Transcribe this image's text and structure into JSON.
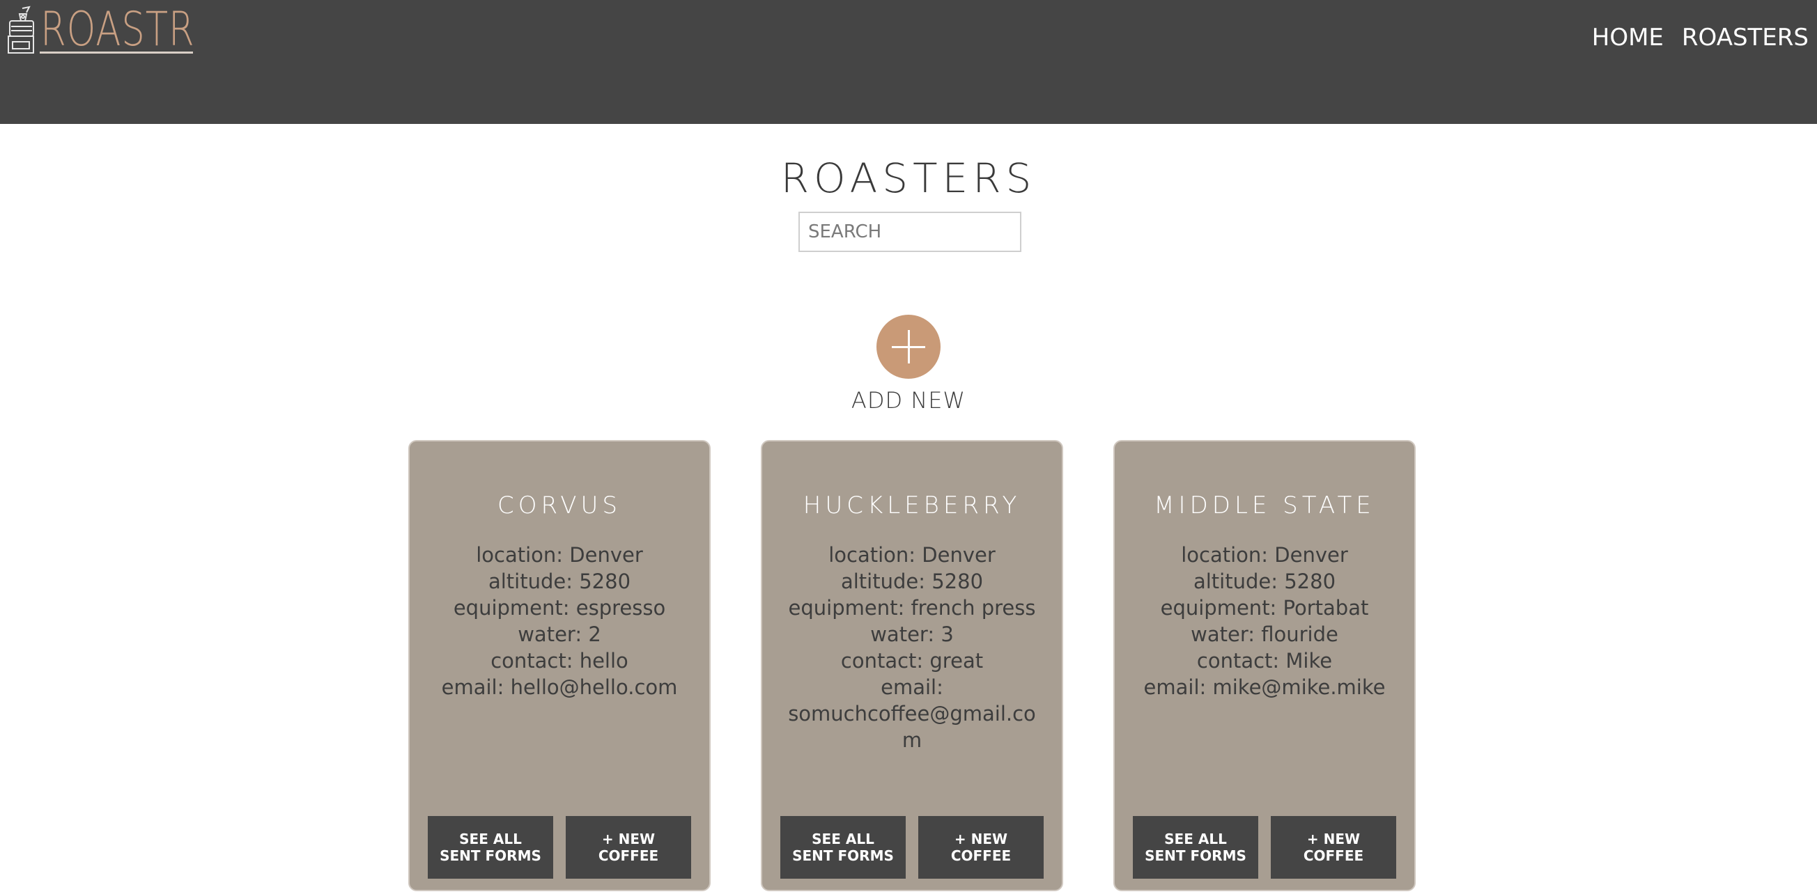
{
  "header": {
    "logo_text": "ROASTR",
    "nav": [
      {
        "label": "HOME"
      },
      {
        "label": "ROASTERS"
      }
    ]
  },
  "main": {
    "title": "ROASTERS",
    "search": {
      "placeholder": "SEARCH",
      "value": ""
    },
    "add_new_label": "ADD NEW"
  },
  "roasters": [
    {
      "name": "CORVUS",
      "details": {
        "location": "location: Denver",
        "altitude": "altitude: 5280",
        "equipment": "equipment: espresso",
        "water": "water: 2",
        "contact": "contact: hello",
        "email": "email: hello@hello.com"
      },
      "buttons": {
        "sent_forms": "SEE ALL SENT FORMS",
        "new_coffee": "+ NEW COFFEE"
      }
    },
    {
      "name": "HUCKLEBERRY",
      "details": {
        "location": "location: Denver",
        "altitude": "altitude: 5280",
        "equipment": "equipment: french press",
        "water": "water: 3",
        "contact": "contact: great",
        "email": "email: somuchcoffee@gmail.com"
      },
      "buttons": {
        "sent_forms": "SEE ALL SENT FORMS",
        "new_coffee": "+ NEW COFFEE"
      }
    },
    {
      "name": "MIDDLE STATE",
      "details": {
        "location": "location: Denver",
        "altitude": "altitude: 5280",
        "equipment": "equipment: Portabat",
        "water": "water: flouride",
        "contact": "contact: Mike",
        "email": "email: mike@mike.mike"
      },
      "buttons": {
        "sent_forms": "SEE ALL SENT FORMS",
        "new_coffee": "+ NEW COFFEE"
      }
    }
  ],
  "colors": {
    "header_bg": "#454545",
    "logo": "#c9a083",
    "accent": "#c99a77",
    "card_bg": "#a89e92",
    "button_bg": "#454545"
  },
  "icons": {
    "logo": "coffee-roaster-icon",
    "add": "plus-icon"
  }
}
